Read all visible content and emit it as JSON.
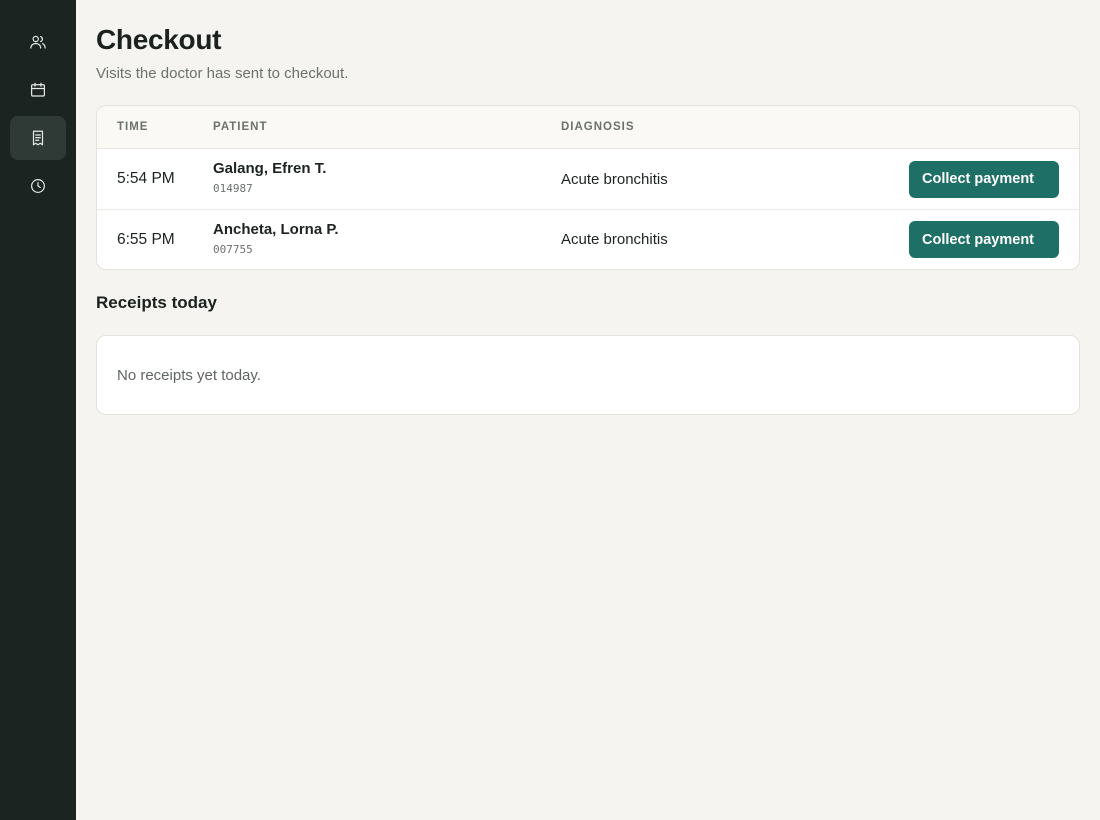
{
  "sidebar": {
    "items": [
      {
        "name": "patients",
        "icon": "users-icon",
        "active": false
      },
      {
        "name": "schedule",
        "icon": "calendar-icon",
        "active": false
      },
      {
        "name": "checkout",
        "icon": "receipt-icon",
        "active": true
      },
      {
        "name": "history",
        "icon": "clock-icon",
        "active": false
      }
    ]
  },
  "header": {
    "title": "Checkout",
    "subtitle": "Visits the doctor has sent to checkout."
  },
  "table": {
    "columns": [
      "TIME",
      "PATIENT",
      "DIAGNOSIS"
    ],
    "rows": [
      {
        "time": "5:54 PM",
        "patient_name": "Galang, Efren T.",
        "patient_id": "014987",
        "diagnosis": "Acute bronchitis",
        "action": "Collect payment"
      },
      {
        "time": "6:55 PM",
        "patient_name": "Ancheta, Lorna P.",
        "patient_id": "007755",
        "diagnosis": "Acute bronchitis",
        "action": "Collect payment"
      }
    ]
  },
  "receipts": {
    "title": "Receipts today",
    "empty_text": "No receipts yet today."
  },
  "colors": {
    "sidebar_bg": "#1c2421",
    "page_bg": "#f5f4f0",
    "accent": "#1e6f66"
  }
}
